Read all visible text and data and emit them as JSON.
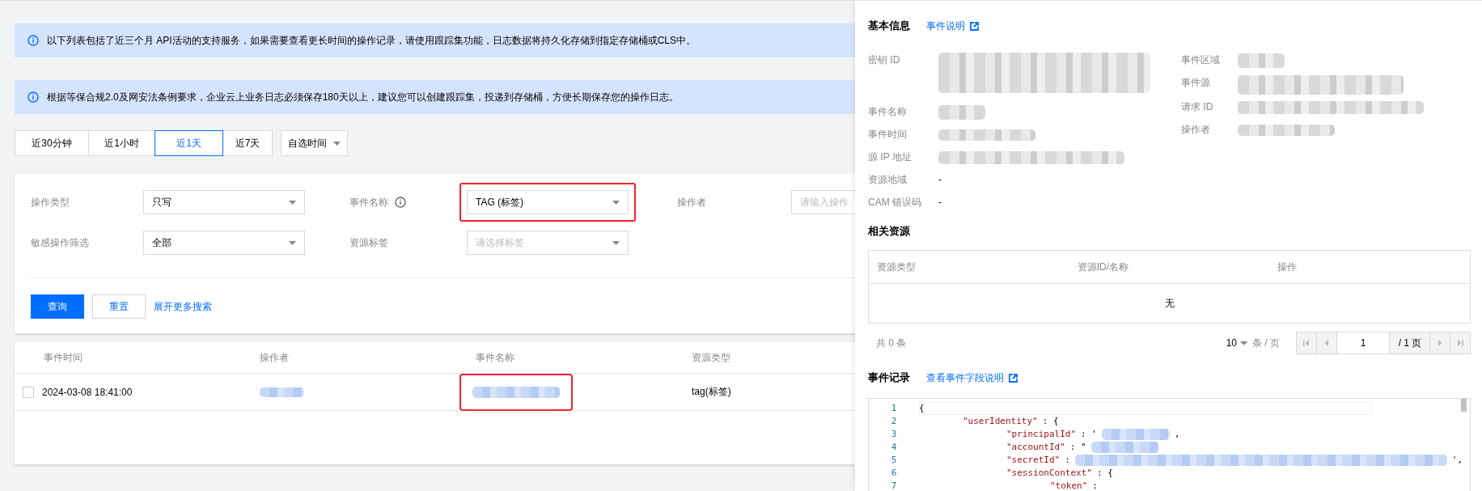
{
  "notices": [
    {
      "text": "以下列表包括了近三个月 API活动的支持服务，如果需要查看更长时间的操作记录，请使用跟踪集功能，日志数据将持久化存储到指定存储桶或CLS中。"
    },
    {
      "text": "根据等保合规2.0及网安法条例要求，企业云上业务日志必须保存180天以上，建议您可以创建跟踪集，投递到存储桶，方便长期保存您的操作日志。"
    }
  ],
  "time_range": {
    "options": [
      {
        "label": "近30分钟",
        "selected": false
      },
      {
        "label": "近1小时",
        "selected": false
      },
      {
        "label": "近1天",
        "selected": true
      },
      {
        "label": "近7天",
        "selected": false
      }
    ],
    "custom": "自选时间"
  },
  "filters": [
    {
      "label": "操作类型",
      "kind": "select",
      "value": "只写",
      "info": false,
      "highlighted": false
    },
    {
      "label": "事件名称",
      "kind": "select",
      "value": "TAG (标签)",
      "info": true,
      "highlighted": true
    },
    {
      "label": "操作者",
      "kind": "input",
      "placeholder": "请输入操作",
      "info": false,
      "highlighted": false
    },
    {
      "label": "敏感操作筛选",
      "kind": "select",
      "value": "全部",
      "info": false,
      "highlighted": false
    },
    {
      "label": "资源标签",
      "kind": "select",
      "placeholder": "请选择标签",
      "info": false,
      "highlighted": false
    }
  ],
  "actions": {
    "search": "查询",
    "reset": "重置",
    "expand": "展开更多搜索"
  },
  "events_table": {
    "columns": [
      "事件时间",
      "操作者",
      "事件名称",
      "资源类型"
    ],
    "rows": [
      {
        "checked": false,
        "cells": [
          {
            "text": "2024-03-08 18:41:00"
          },
          {
            "redacted": true,
            "highlighted": false
          },
          {
            "redacted": true,
            "highlighted": true
          },
          {
            "text": "tag(标签)"
          }
        ]
      }
    ]
  },
  "detail": {
    "basic_info": {
      "title": "基本信息",
      "link": "事件说明",
      "left": [
        {
          "label": "密钥 ID",
          "redacted": true
        },
        {
          "label": "事件名称",
          "redacted": true
        },
        {
          "label": "事件时间",
          "redacted": true
        },
        {
          "label": "源 IP 地址",
          "redacted": true
        },
        {
          "label": "资源地域",
          "value": "-"
        },
        {
          "label": "CAM 错误码",
          "value": "-"
        }
      ],
      "right": [
        {
          "label": "事件区域",
          "redacted": true
        },
        {
          "label": "事件源",
          "redacted": true
        },
        {
          "label": "请求 ID",
          "redacted": true
        },
        {
          "label": "操作者",
          "redacted": true
        }
      ]
    },
    "related": {
      "title": "相关资源",
      "columns": [
        "资源类型",
        "资源ID/名称",
        "操作"
      ],
      "empty": "无",
      "total": "共 0 条",
      "page_size": "10",
      "page_size_unit": "条 / 页",
      "page": "1",
      "page_total": "/ 1 页",
      "pager_disabled": true
    },
    "record": {
      "title": "事件记录",
      "link": "查看事件字段说明",
      "lines": [
        {
          "number": "1",
          "current": true,
          "parts": [
            {
              "kind": "punct",
              "text": "{"
            }
          ],
          "children": [
            {
              "number": "2",
              "current": false,
              "parts": [
                {
                  "kind": "key",
                  "text": "\"userIdentity\""
                },
                {
                  "kind": "punct",
                  "text": ": {"
                }
              ],
              "children": [
                {
                  "number": "3",
                  "current": false,
                  "parts": [
                    {
                      "kind": "key",
                      "text": "\"principalId\""
                    },
                    {
                      "kind": "punct",
                      "text": ": '"
                    },
                    {
                      "kind": "redacted"
                    },
                    {
                      "kind": "punct",
                      "text": ","
                    }
                  ]
                },
                {
                  "number": "4",
                  "current": false,
                  "parts": [
                    {
                      "kind": "key",
                      "text": "\"accountId\""
                    },
                    {
                      "kind": "punct",
                      "text": ": \""
                    },
                    {
                      "kind": "redacted"
                    }
                  ]
                },
                {
                  "number": "5",
                  "current": false,
                  "parts": [
                    {
                      "kind": "key",
                      "text": "\"secretId\""
                    },
                    {
                      "kind": "punct",
                      "text": ":"
                    },
                    {
                      "kind": "redacted"
                    },
                    {
                      "kind": "punct",
                      "text": "',"
                    }
                  ]
                },
                {
                  "number": "6",
                  "current": false,
                  "parts": [
                    {
                      "kind": "key",
                      "text": "\"sessionContext\""
                    },
                    {
                      "kind": "punct",
                      "text": ": {"
                    }
                  ],
                  "children": [
                    {
                      "number": "7",
                      "current": false,
                      "parts": [
                        {
                          "kind": "key",
                          "text": "\"token\""
                        },
                        {
                          "kind": "punct",
                          "text": ":"
                        }
                      ]
                    }
                  ]
                }
              ]
            }
          ]
        }
      ]
    }
  }
}
